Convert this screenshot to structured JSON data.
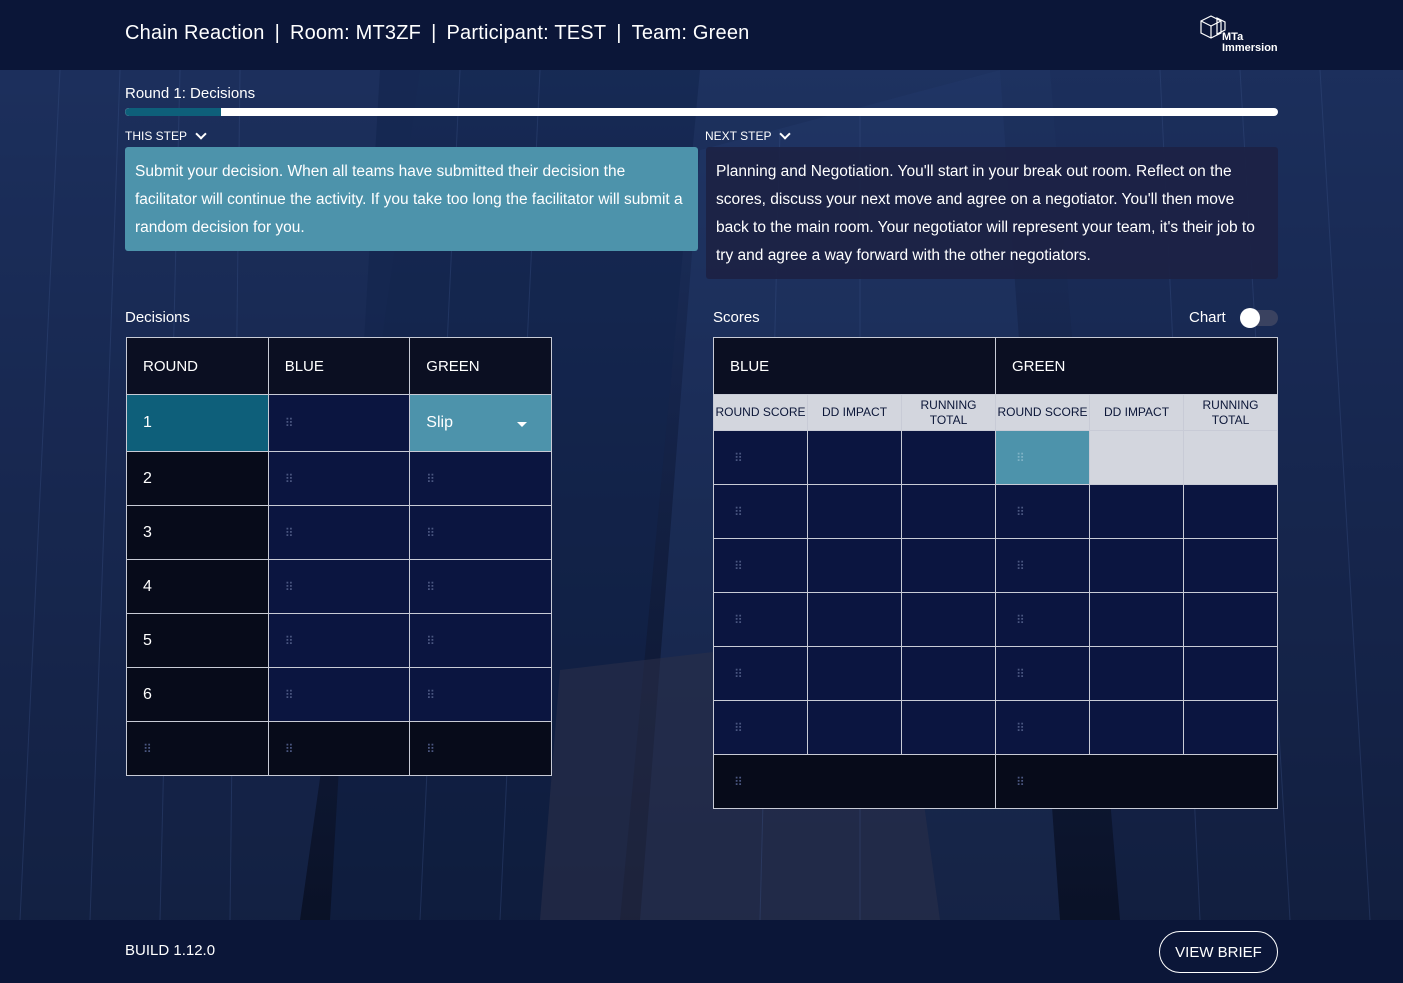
{
  "header": {
    "app_name": "Chain Reaction",
    "room": "Room: MT3ZF",
    "participant": "Participant: TEST",
    "team": "Team: Green",
    "separator": "|",
    "logo_line1": "MTa",
    "logo_line2": "Immersion"
  },
  "progress": {
    "label": "Round 1: Decisions",
    "fraction": 0.083
  },
  "this_step": {
    "label": "THIS STEP",
    "text": "Submit your decision. When all teams have submitted their decision the facilitator will continue the activity. If you take too long the facilitator will submit a random decision for you."
  },
  "next_step": {
    "label": "NEXT STEP",
    "text": "Planning and Negotiation. You'll start in your break out room. Reflect on the scores, discuss your next move and agree on a negotiator. You'll then move back to the main room. Your negotiator will represent your team, it's their job to try and agree a way forward with the other negotiators."
  },
  "decisions": {
    "title": "Decisions",
    "headers": [
      "ROUND",
      "BLUE",
      "GREEN"
    ],
    "rounds": [
      "1",
      "2",
      "3",
      "4",
      "5",
      "6"
    ],
    "green_selected": "Slip",
    "grip": "⠿"
  },
  "scores": {
    "title": "Scores",
    "chart_label": "Chart",
    "chart_on": false,
    "teams": [
      "BLUE",
      "GREEN"
    ],
    "subheaders": [
      "ROUND SCORE",
      "DD IMPACT",
      "RUNNING TOTAL"
    ]
  },
  "footer": {
    "build": "BUILD 1.12.0",
    "view_brief": "VIEW BRIEF"
  },
  "colors": {
    "accent_teal": "#4d93ab",
    "active_teal": "#0e5f7a",
    "navy": "#0b1638"
  }
}
